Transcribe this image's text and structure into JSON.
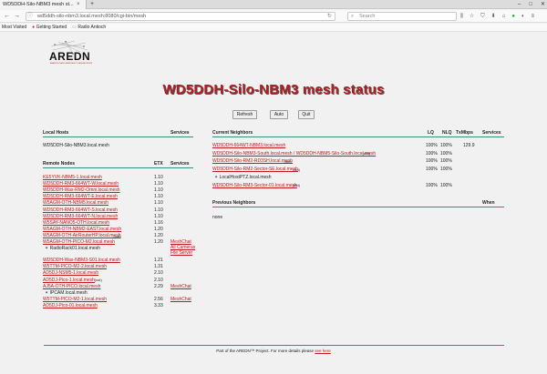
{
  "browser": {
    "tab_title": "WD5DDH-Silo-NBM3 mesh st...",
    "url": "wd5ddh-silo-nbm3.local.mesh:8080/cgi-bin/mesh",
    "search_placeholder": "Search",
    "bookmarks": [
      "Most Visited",
      "Getting Started",
      "Radio Antioch"
    ]
  },
  "logo": {
    "text": "AREDN",
    "tagline": "AMATEUR RADIO EMERGENCY DATA NETWORK"
  },
  "title": "WD5DDH-Silo-NBM3 mesh status",
  "buttons": {
    "refresh": "Refresh",
    "auto": "Auto",
    "quit": "Quit"
  },
  "local_hosts": {
    "header": "Local Hosts",
    "services_header": "Services",
    "rows": [
      "WD5DDH-Silo-NBM3.local.mesh"
    ]
  },
  "remote_nodes": {
    "header": "Remote Nodes",
    "etx_header": "ETX",
    "services_header": "Services",
    "rows": [
      {
        "name": "KE5YVK-NBM5-1.local.mesh",
        "etx": "1.10"
      },
      {
        "name": "WD5DDH-RM3-664WT-W.local.mesh",
        "etx": "1.10"
      },
      {
        "name": "WD5DDH-Wax-RM2-Omni.local.mesh",
        "etx": "1.10"
      },
      {
        "name": "WD5DDH-RM3-664WT-E.local.mesh",
        "etx": "1.10"
      },
      {
        "name": "W5AGM-OTH-NBM5.local.mesh",
        "etx": "1.10"
      },
      {
        "name": "WD5DDH-RM3-664WT-S.local.mesh",
        "etx": "1.10"
      },
      {
        "name": "WD5DDH-RM3-664WT-N.local.mesh",
        "etx": "1.10"
      },
      {
        "name": "W5SAY-NANO5-OTH.local.mesh",
        "etx": "1.16"
      },
      {
        "name": "W5AGM-OTH-NBM2-EAST.local.mesh",
        "etx": "1.20"
      },
      {
        "name": "W5AGM-OTH-AirRouterHP.local.mesh",
        "etx": "1.20",
        "tag": "(nat)"
      },
      {
        "name": "W5AGM-OTH-PICO-M2.local.mesh",
        "etx": "1.20",
        "services": [
          "MeshChat",
          "All Cameras",
          "File Server"
        ],
        "sub": "RadioRack01.local.mesh"
      },
      {
        "name": "WD5DDH-Wax-NBM3-S01.local.mesh",
        "etx": "1.21"
      },
      {
        "name": "W5TTM-PICO-M2-2.local.mesh",
        "etx": "1.31"
      },
      {
        "name": "AD5DJ-NSM5-1.local.mesh",
        "etx": "2.10"
      },
      {
        "name": "AD5DJ-Pico-1.local.mesh",
        "etx": "2.10",
        "tag": "(nat)"
      },
      {
        "name": "AJ5A-OTH-PICO.local.mesh",
        "etx": "2.29",
        "services": [
          "MeshChat"
        ],
        "sub": "IPCAM.local.mesh"
      },
      {
        "name": "W5TTM-PICO-M2-1.local.mesh",
        "etx": "2.56",
        "services": [
          "MeshChat"
        ]
      },
      {
        "name": "AD5DJ-Pico-01.local.mesh",
        "etx": "3.33"
      }
    ]
  },
  "current_neighbors": {
    "header": "Current Neighbors",
    "lq_header": "LQ",
    "nlq_header": "NLQ",
    "tx_header": "TxMbps",
    "services_header": "Services",
    "rows": [
      {
        "name": "WD5DDH-664WT-NBM3.local.mesh",
        "lq": "100%",
        "nlq": "100%",
        "tx": "129.9"
      },
      {
        "name": "WD5DDH-Silo-NBM3-South.local.mesh / WD5DDH-NBM5-Silo-South.local.mesh",
        "tag": "(dtd)",
        "lq": "100%",
        "nlq": "100%",
        "tx": ""
      },
      {
        "name": "WD5DDH-Silo-RM2-RD3SH.local.mesh",
        "tag": "(dtd)",
        "lq": "100%",
        "nlq": "100%",
        "tx": ""
      },
      {
        "name": "WD5DDH-Silo-RM2-Sector-SE.local.mesh",
        "tag": "(dtd)",
        "lq": "100%",
        "nlq": "100%",
        "tx": "",
        "sub": "LocalHostPTZ.local.mesh"
      },
      {
        "name": "WD5DDH-Silo-RM3-Sector-01.local.mesh",
        "tag": "(dtd)",
        "lq": "100%",
        "nlq": "100%",
        "tx": ""
      }
    ]
  },
  "previous_neighbors": {
    "header": "Previous Neighbors",
    "when_header": "When",
    "empty_text": "none"
  },
  "footer": {
    "text": "Part of the AREDN™ Project. For more details please",
    "link": "see here"
  }
}
